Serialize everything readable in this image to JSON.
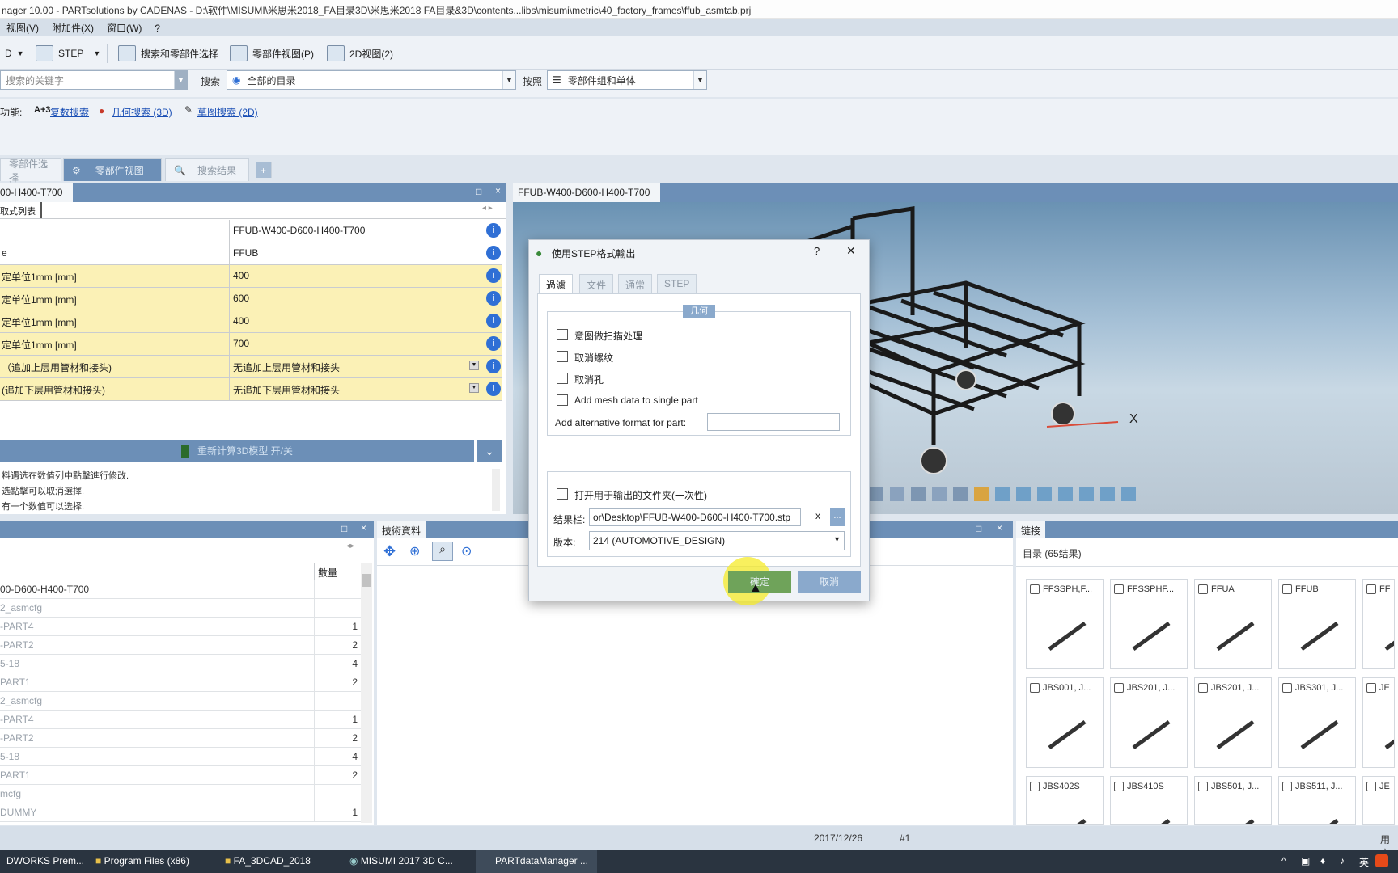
{
  "window": {
    "title": "nager 10.00 - PARTsolutions by CADENAS - D:\\软件\\MISUMI\\米思米2018_FA目录3D\\米思米2018 FA目录&3D\\contents...libs\\misumi\\metric\\40_factory_frames\\ffub_asmtab.prj"
  },
  "menu": [
    "视图(V)",
    "附加件(X)",
    "窗口(W)",
    "?"
  ],
  "toolbar": {
    "prefix": "D",
    "step_label": "STEP",
    "search_select": "搜索和零部件选择",
    "part_view": "零部件视图(P)",
    "view_2d": "2D视图(2)"
  },
  "search": {
    "keyword_placeholder": "搜索的关键字",
    "search_label": "搜索",
    "catalog_value": "全部的目录",
    "by_label": "按照",
    "scope_value": "零部件组和单体"
  },
  "functions": {
    "label": "功能:",
    "link1_prefix": "A+3",
    "link1": "复数搜索",
    "link2": "几何搜索 (3D)",
    "link3": "草图搜索 (2D)"
  },
  "tabs": {
    "part_select": "零部件选择",
    "part_view": "零部件视图",
    "search_results": "搜索结果",
    "add": "+"
  },
  "left_panel": {
    "title": "00-H400-T700",
    "subtab": "取式列表",
    "rows": [
      {
        "key": "",
        "value": "FFUB-W400-D600-H400-T700",
        "highlight": false
      },
      {
        "key": "e",
        "value": "FFUB",
        "highlight": false
      },
      {
        "key": "定单位1mm [mm]",
        "value": "400",
        "highlight": true
      },
      {
        "key": "定单位1mm [mm]",
        "value": "600",
        "highlight": true
      },
      {
        "key": "定单位1mm [mm]",
        "value": "400",
        "highlight": true
      },
      {
        "key": "定单位1mm [mm]",
        "value": "700",
        "highlight": true
      },
      {
        "key": "（追加上层用管材和接头)",
        "value": "无追加上层用管材和接头",
        "highlight": true
      },
      {
        "key": "(追加下层用管材和接头)",
        "value": "无追加下层用管材和接头",
        "highlight": true
      }
    ],
    "recalc_label": "重新计算3D模型 开/关",
    "notes": [
      "料遇选在数值列中點擊進行修改.",
      "选點擊可以取消選擇.",
      "有一个数值可以选择."
    ]
  },
  "bottom_left": {
    "qty_header": "數量",
    "rows": [
      {
        "name": "00-D600-H400-T700",
        "qty": "",
        "gray": false
      },
      {
        "name": "2_asmcfg",
        "qty": "",
        "gray": true
      },
      {
        "name": "-PART4",
        "qty": "1",
        "gray": true
      },
      {
        "name": "-PART2",
        "qty": "2",
        "gray": true
      },
      {
        "name": "5-18",
        "qty": "4",
        "gray": true
      },
      {
        "name": "PART1",
        "qty": "2",
        "gray": true
      },
      {
        "name": "2_asmcfg",
        "qty": "",
        "gray": true
      },
      {
        "name": "-PART4",
        "qty": "1",
        "gray": true
      },
      {
        "name": "-PART2",
        "qty": "2",
        "gray": true
      },
      {
        "name": "5-18",
        "qty": "4",
        "gray": true
      },
      {
        "name": "PART1",
        "qty": "2",
        "gray": true
      },
      {
        "name": "mcfg",
        "qty": "",
        "gray": true
      },
      {
        "name": "DUMMY",
        "qty": "1",
        "gray": true
      }
    ]
  },
  "tech": {
    "title": "技術資料"
  },
  "viewer": {
    "title": "FFUB-W400-D600-H400-T700",
    "axis_x": "X"
  },
  "links": {
    "title": "链接",
    "count_label": "目录 (65结果)",
    "cards": [
      {
        "name": "FFSSPH,F..."
      },
      {
        "name": "FFSSPHF..."
      },
      {
        "name": "FFUA"
      },
      {
        "name": "FFUB"
      },
      {
        "name": "FF"
      },
      {
        "name": "JBS001, J..."
      },
      {
        "name": "JBS201, J..."
      },
      {
        "name": "JBS201, J..."
      },
      {
        "name": "JBS301, J..."
      },
      {
        "name": "JE"
      },
      {
        "name": "JBS402S"
      },
      {
        "name": "JBS410S"
      },
      {
        "name": "JBS501, J..."
      },
      {
        "name": "JBS511, J..."
      },
      {
        "name": "JE"
      }
    ]
  },
  "dialog": {
    "title": "使用STEP格式輸出",
    "help": "?",
    "close": "✕",
    "tabs": [
      "過濾",
      "文件",
      "通常",
      "STEP"
    ],
    "group_label": "几何",
    "options": [
      "意图做扫描处理",
      "取消螺纹",
      "取消孔",
      "Add mesh data to single part"
    ],
    "alt_format_label": "Add alternative format for part:",
    "open_folder": "打开用于输出的文件夹(一次性)",
    "result_label": "结果栏:",
    "result_value": "or\\Desktop\\FFUB-W400-D600-H400-T700.stp",
    "result_clear": "x",
    "browse": "...",
    "version_label": "版本:",
    "version_value": "214 (AUTOMOTIVE_DESIGN)",
    "ok": "確定",
    "cancel": "取消"
  },
  "status": {
    "date": "2017/12/26",
    "page": "#1",
    "user": "用户"
  },
  "taskbar": {
    "items": [
      "DWORKS Prem...",
      "Program Files (x86)",
      "FA_3DCAD_2018",
      "MISUMI 2017 3D C...",
      "PARTdataManager ..."
    ],
    "ime": "英"
  }
}
